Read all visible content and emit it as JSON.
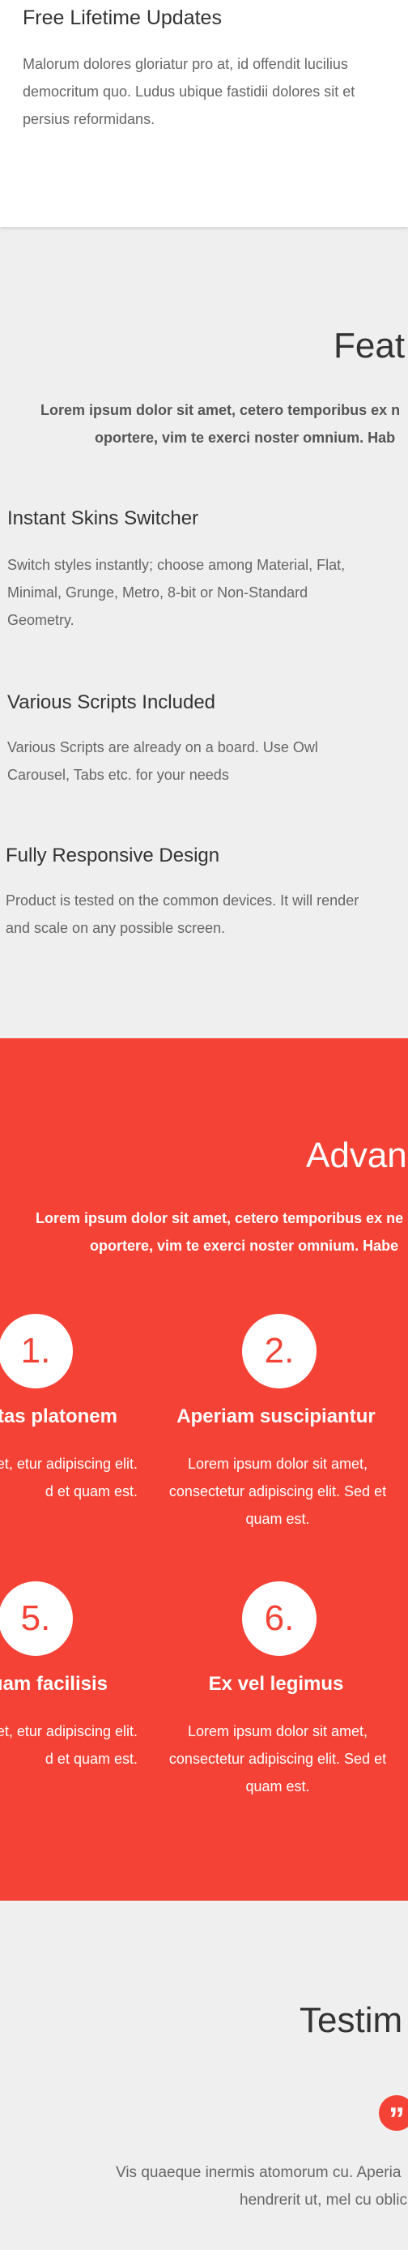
{
  "top_card": {
    "title": "Free Lifetime Updates",
    "text": "Malorum dolores gloriatur pro at, id offendit lucilius democritum quo. Ludus ubique fastidii dolores sit et persius reformidans."
  },
  "features": {
    "title": "Feat",
    "subtitle_line1": "Lorem ipsum dolor sit amet, cetero temporibus ex n",
    "subtitle_line2": "oportere, vim te exerci noster omnium. Hab",
    "items": [
      {
        "title": "Instant Skins Switcher",
        "text": "Switch styles instantly; choose among Material, Flat, Minimal, Grunge, Metro, 8-bit or Non-Standard Geometry."
      },
      {
        "title": "Various Scripts Included",
        "text": "Various Scripts are already on a board. Use Owl Carousel, Tabs etc. for your needs"
      },
      {
        "title": "Fully Responsive Design",
        "text": "Product is tested on the common devices. It will render and scale on any possible screen."
      }
    ]
  },
  "advantages": {
    "title": "Advan",
    "subtitle_line1": "Lorem ipsum dolor sit amet, cetero temporibus ex ne",
    "subtitle_line2": "oportere, vim te exerci noster omnium. Habe",
    "accent_color": "#f44336",
    "items": [
      {
        "number": "1.",
        "title": "ntas platonem",
        "text": "sum dolor sit amet, etur adipiscing elit. d et quam est."
      },
      {
        "number": "2.",
        "title": "Aperiam suscipiantur",
        "text": "Lorem ipsum dolor sit amet, consectetur adipiscing elit. Sed et quam est."
      },
      {
        "number": "5.",
        "title": "quam facilisis",
        "text": "sum dolor sit amet, etur adipiscing elit. d et quam est."
      },
      {
        "number": "6.",
        "title": "Ex vel legimus",
        "text": "Lorem ipsum dolor sit amet, consectetur adipiscing elit. Sed et quam est."
      }
    ]
  },
  "testimonials": {
    "title": "Testim",
    "quote_icon": "quote-icon",
    "text_line1": "Vis quaeque inermis atomorum cu. Aperia",
    "text_line2": "hendrerit ut, mel cu oblic"
  }
}
